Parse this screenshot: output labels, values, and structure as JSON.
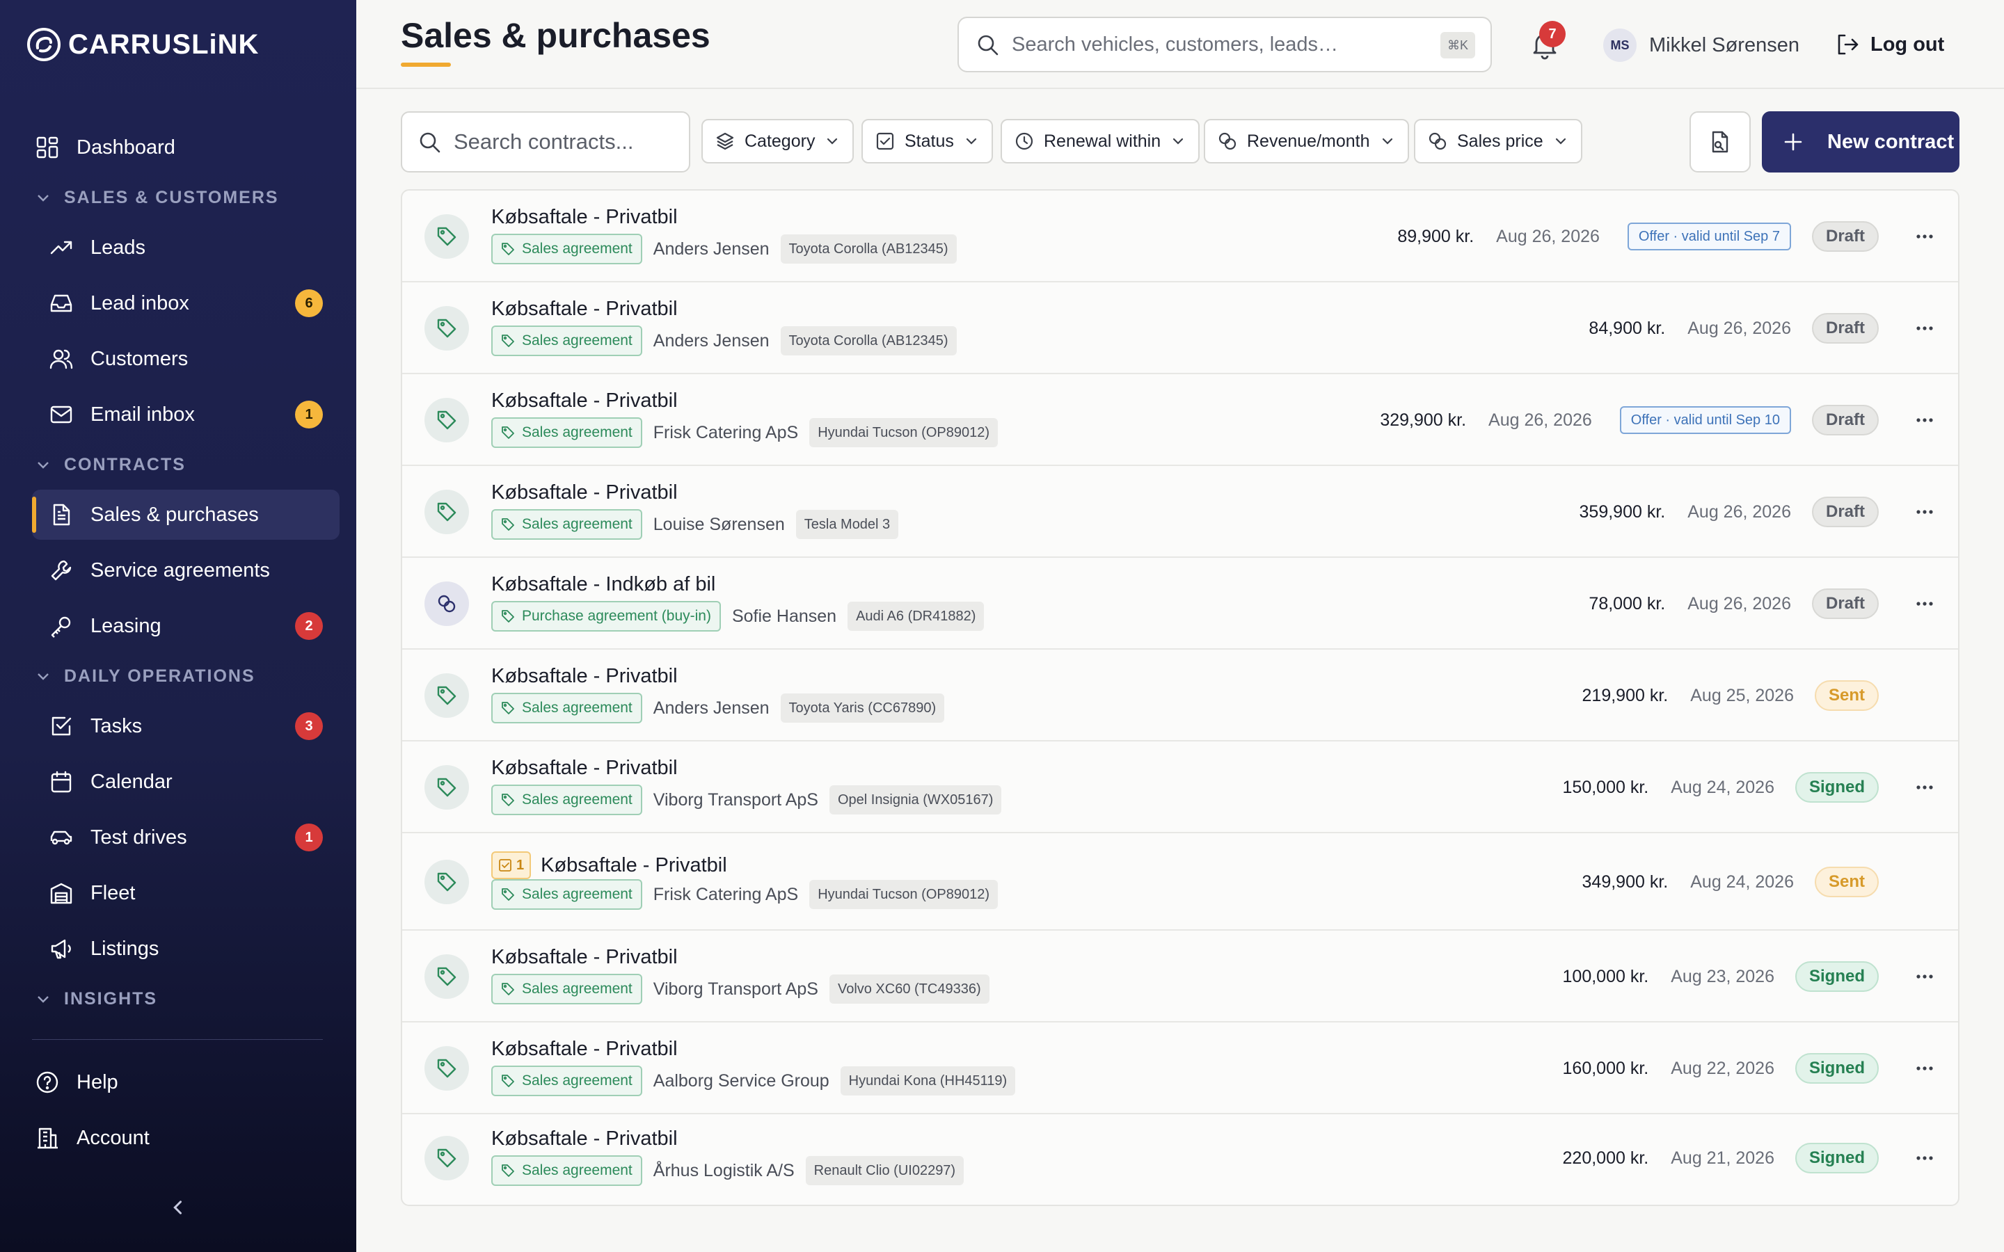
{
  "app": {
    "logo_text": "CARRUSLiNK"
  },
  "page": {
    "title": "Sales & purchases"
  },
  "sidebar": {
    "dashboard": "Dashboard",
    "sections": {
      "sales_customers": "SALES & CUSTOMERS",
      "contracts": "CONTRACTS",
      "daily_operations": "DAILY OPERATIONS",
      "insights": "INSIGHTS"
    },
    "items": {
      "leads": {
        "label": "Leads"
      },
      "lead_inbox": {
        "label": "Lead inbox",
        "badge": "6"
      },
      "customers": {
        "label": "Customers"
      },
      "email_inbox": {
        "label": "Email inbox",
        "badge": "1"
      },
      "sales_purchases": {
        "label": "Sales & purchases"
      },
      "service_agreements": {
        "label": "Service agreements"
      },
      "leasing": {
        "label": "Leasing",
        "badge": "2"
      },
      "tasks": {
        "label": "Tasks",
        "badge": "3"
      },
      "calendar": {
        "label": "Calendar"
      },
      "test_drives": {
        "label": "Test drives",
        "badge": "1"
      },
      "fleet": {
        "label": "Fleet"
      },
      "listings": {
        "label": "Listings"
      }
    },
    "help": "Help",
    "account": "Account"
  },
  "header": {
    "search_placeholder": "Search vehicles, customers, leads…",
    "search_shortcut": "⌘K",
    "notification_count": "7",
    "user_initials": "MS",
    "user_name": "Mikkel Sørensen",
    "logout": "Log out"
  },
  "filters": {
    "search_placeholder": "Search contracts...",
    "category": "Category",
    "status": "Status",
    "renewal": "Renewal within",
    "revenue": "Revenue/month",
    "sales_price": "Sales price",
    "new_contract": "New contract"
  },
  "colors": {
    "accent": "#f0a930",
    "brand": "#2b2f6b",
    "sidebar": "#1f2352"
  },
  "rows": [
    {
      "title": "Købsaftale - Privatbil",
      "type": "Sales agreement",
      "customer": "Anders Jensen",
      "vehicle": "Toyota Corolla (AB12345)",
      "price": "89,900 kr.",
      "date": "Aug 26, 2026",
      "offer": "Offer · valid until Sep 7",
      "status": "Draft"
    },
    {
      "title": "Købsaftale - Privatbil",
      "type": "Sales agreement",
      "customer": "Anders Jensen",
      "vehicle": "Toyota Corolla (AB12345)",
      "price": "84,900 kr.",
      "date": "Aug 26, 2026",
      "status": "Draft"
    },
    {
      "title": "Købsaftale - Privatbil",
      "type": "Sales agreement",
      "customer": "Frisk Catering ApS",
      "vehicle": "Hyundai Tucson (OP89012)",
      "price": "329,900 kr.",
      "date": "Aug 26, 2026",
      "offer": "Offer · valid until Sep 10",
      "status": "Draft"
    },
    {
      "title": "Købsaftale - Privatbil",
      "type": "Sales agreement",
      "customer": "Louise Sørensen",
      "vehicle": "Tesla Model 3",
      "price": "359,900 kr.",
      "date": "Aug 26, 2026",
      "status": "Draft"
    },
    {
      "title": "Købsaftale - Indkøb af bil",
      "type": "Purchase agreement (buy-in)",
      "customer": "Sofie Hansen",
      "vehicle": "Audi A6 (DR41882)",
      "price": "78,000 kr.",
      "date": "Aug 26, 2026",
      "status": "Draft"
    },
    {
      "title": "Købsaftale - Privatbil",
      "type": "Sales agreement",
      "customer": "Anders Jensen",
      "vehicle": "Toyota Yaris (CC67890)",
      "price": "219,900 kr.",
      "date": "Aug 25, 2026",
      "status": "Sent"
    },
    {
      "title": "Købsaftale - Privatbil",
      "type": "Sales agreement",
      "customer": "Viborg Transport ApS",
      "vehicle": "Opel Insignia (WX05167)",
      "price": "150,000 kr.",
      "date": "Aug 24, 2026",
      "status": "Signed"
    },
    {
      "title": "Købsaftale - Privatbil",
      "task_count": "1",
      "type": "Sales agreement",
      "customer": "Frisk Catering ApS",
      "vehicle": "Hyundai Tucson (OP89012)",
      "price": "349,900 kr.",
      "date": "Aug 24, 2026",
      "status": "Sent"
    },
    {
      "title": "Købsaftale - Privatbil",
      "type": "Sales agreement",
      "customer": "Viborg Transport ApS",
      "vehicle": "Volvo XC60 (TC49336)",
      "price": "100,000 kr.",
      "date": "Aug 23, 2026",
      "status": "Signed"
    },
    {
      "title": "Købsaftale - Privatbil",
      "type": "Sales agreement",
      "customer": "Aalborg Service Group",
      "vehicle": "Hyundai Kona (HH45119)",
      "price": "160,000 kr.",
      "date": "Aug 22, 2026",
      "status": "Signed"
    },
    {
      "title": "Købsaftale - Privatbil",
      "type": "Sales agreement",
      "customer": "Århus Logistik A/S",
      "vehicle": "Renault Clio (UI02297)",
      "price": "220,000 kr.",
      "date": "Aug 21, 2026",
      "status": "Signed"
    }
  ]
}
